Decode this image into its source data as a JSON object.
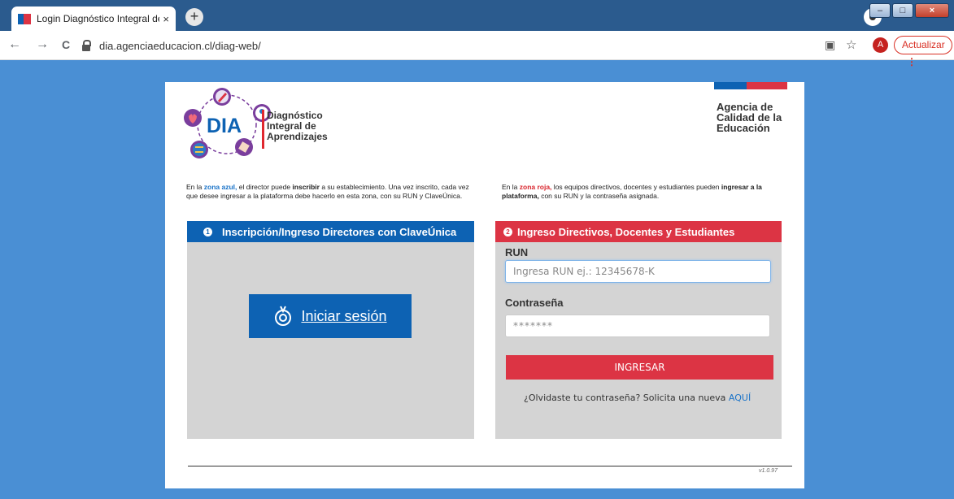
{
  "browser": {
    "tab_title": "Login Diagnóstico Integral de Ap",
    "tab_close": "×",
    "new_tab": "+",
    "url": "dia.agenciaeducacion.cl/diag-web/",
    "avatar_letter": "A",
    "update_label": "Actualizar",
    "update_dots": "⋮",
    "back": "←",
    "forward": "→",
    "reload": "C",
    "star": "☆",
    "translate": "▣"
  },
  "header": {
    "logo_brand": "DIA",
    "logo_lines": [
      "Diagnóstico",
      "Integral de",
      "Aprendizajes"
    ],
    "agency_lines": [
      "Agencia de",
      "Calidad de la",
      "Educación"
    ]
  },
  "intro_left": {
    "t1": "En la ",
    "zone": "zona azul,",
    "t2": " el director puede ",
    "action": "inscribir",
    "t3": " a su establecimiento. Una vez inscrito, cada vez que desee ingresar a la plataforma debe hacerlo en esta zona, con su RUN y ClaveÚnica."
  },
  "intro_right": {
    "t1": "En la ",
    "zone": "zona roja,",
    "t2": " los equipos directivos, docentes y estudiantes pueden ",
    "action": "ingresar a la plataforma,",
    "t3": " con su RUN y la contraseña asignada."
  },
  "left_panel": {
    "number": "1",
    "title": "Inscripción/Ingreso Directores con ClaveÚnica",
    "login_button": "Iniciar sesión"
  },
  "right_panel": {
    "number": "2",
    "title": "Ingreso Directivos, Docentes y Estudiantes",
    "run_label": "RUN",
    "run_placeholder": "Ingresa RUN ej.: 12345678-K",
    "password_label": "Contraseña",
    "password_placeholder": "*******",
    "submit_label": "INGRESAR",
    "forgot_text": "¿Olvidaste tu contraseña? Solicita una nueva ",
    "forgot_link": "AQUÍ"
  },
  "footer": {
    "version": "v1.0.97"
  },
  "colors": {
    "background": "#4a8fd4",
    "blue": "#0d62b3",
    "red": "#dc3444",
    "panel_bg": "#d4d4d4",
    "link": "#1a73c8"
  }
}
